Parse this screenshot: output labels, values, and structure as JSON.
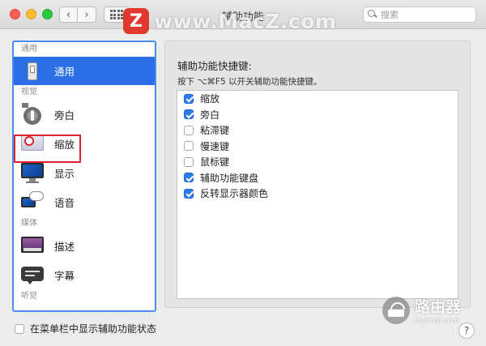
{
  "window": {
    "title": "辅助功能",
    "nav_back": "‹",
    "nav_forward": "›",
    "search_placeholder": "搜索"
  },
  "watermark": {
    "badge": "Z",
    "text": "www.MacZ.com",
    "router_text": "路由器",
    "router_domain": "luyouqi.com"
  },
  "sidebar": {
    "sections": [
      {
        "header": "通用",
        "items": [
          {
            "label": "通用",
            "icon": "general-icon",
            "selected": true
          }
        ]
      },
      {
        "header": "视觉",
        "items": [
          {
            "label": "旁白",
            "icon": "voiceover-icon"
          },
          {
            "label": "缩放",
            "icon": "zoom-icon",
            "highlighted": true
          },
          {
            "label": "显示",
            "icon": "display-icon"
          },
          {
            "label": "语音",
            "icon": "speech-icon"
          }
        ]
      },
      {
        "header": "媒体",
        "items": [
          {
            "label": "描述",
            "icon": "descriptions-icon"
          },
          {
            "label": "字幕",
            "icon": "captions-icon"
          }
        ]
      },
      {
        "header": "听觉",
        "items": []
      }
    ]
  },
  "main": {
    "title": "辅助功能快捷键:",
    "subtitle": "按下 ⌥⌘F5 以开关辅助功能快捷键。",
    "options": [
      {
        "label": "缩放",
        "checked": true
      },
      {
        "label": "旁白",
        "checked": true
      },
      {
        "label": "粘滞键",
        "checked": false
      },
      {
        "label": "慢速键",
        "checked": false
      },
      {
        "label": "鼠标键",
        "checked": false
      },
      {
        "label": "辅助功能键盘",
        "checked": true
      },
      {
        "label": "反转显示器颜色",
        "checked": true
      }
    ]
  },
  "footer": {
    "menubar_status_label": "在菜单栏中显示辅助功能状态",
    "menubar_status_checked": false,
    "help": "?"
  },
  "colors": {
    "accent": "#2a6fe6",
    "checkbox_on": "#2d7bf0",
    "highlight_box": "#d9232f"
  }
}
